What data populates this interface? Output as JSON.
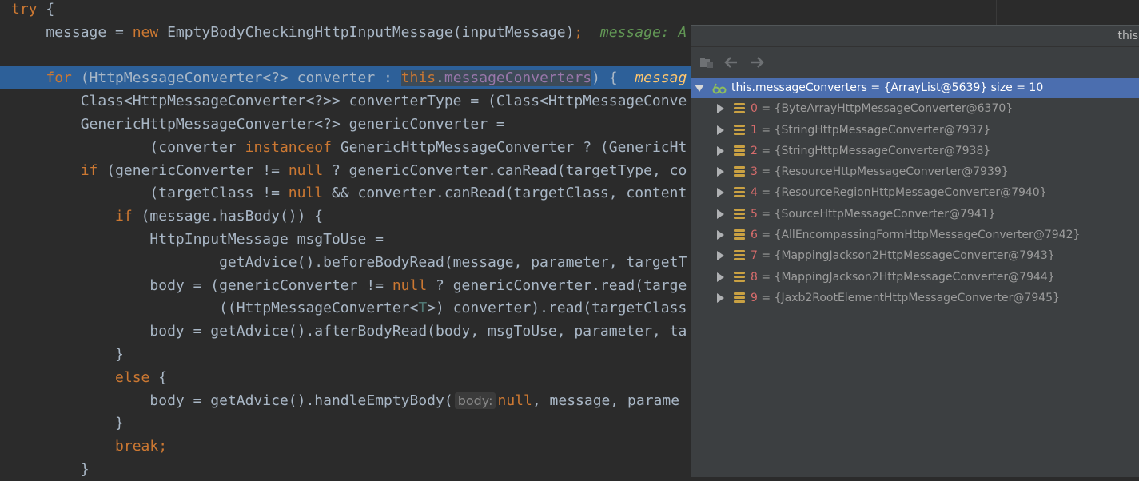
{
  "editor": {
    "lines": [
      [
        {
          "t": "try",
          "c": "kw"
        },
        {
          "t": " {",
          "c": "id"
        }
      ],
      [
        {
          "t": "    message = ",
          "c": "id"
        },
        {
          "t": "new",
          "c": "kw"
        },
        {
          "t": " EmptyBodyCheckingHttpInputMessage(inputMessage)",
          "c": "id"
        },
        {
          "t": ";",
          "c": "kw"
        },
        {
          "t": "  message: ",
          "c": "hint"
        },
        {
          "t": "A",
          "c": "hint"
        }
      ],
      [],
      [
        {
          "t": "    ",
          "c": "id"
        },
        {
          "t": "for",
          "c": "kw"
        },
        {
          "t": " (HttpMessageConverter<?> converter : ",
          "c": "id"
        },
        {
          "t": "this",
          "c": "kw sel"
        },
        {
          "t": ".",
          "c": "id sel"
        },
        {
          "t": "messageConverters",
          "c": "field sel"
        },
        {
          "t": ") {  ",
          "c": "id"
        },
        {
          "t": "messag",
          "c": "inline"
        }
      ],
      [
        {
          "t": "        Class<HttpMessageConverter<?>> converterType = (Class<HttpMessageConve",
          "c": "id"
        }
      ],
      [
        {
          "t": "        GenericHttpMessageConverter<?> genericConverter =",
          "c": "id"
        }
      ],
      [
        {
          "t": "                (converter ",
          "c": "id"
        },
        {
          "t": "instanceof",
          "c": "kw"
        },
        {
          "t": " GenericHttpMessageConverter ? (GenericHt",
          "c": "id"
        }
      ],
      [
        {
          "t": "        ",
          "c": "id"
        },
        {
          "t": "if",
          "c": "kw"
        },
        {
          "t": " (genericConverter != ",
          "c": "id"
        },
        {
          "t": "null",
          "c": "kw"
        },
        {
          "t": " ? genericConverter.canRead(targetType, co",
          "c": "id"
        }
      ],
      [
        {
          "t": "                (targetClass != ",
          "c": "id"
        },
        {
          "t": "null",
          "c": "kw"
        },
        {
          "t": " && converter.canRead(targetClass, content",
          "c": "id"
        }
      ],
      [
        {
          "t": "            ",
          "c": "id"
        },
        {
          "t": "if",
          "c": "kw"
        },
        {
          "t": " (message.hasBody()) {",
          "c": "id"
        }
      ],
      [
        {
          "t": "                HttpInputMessage msgToUse =",
          "c": "id"
        }
      ],
      [
        {
          "t": "                        getAdvice().beforeBodyRead(message, parameter, targetT",
          "c": "id"
        }
      ],
      [
        {
          "t": "                body = (genericConverter != ",
          "c": "id"
        },
        {
          "t": "null",
          "c": "kw"
        },
        {
          "t": " ? genericConverter.read(targe",
          "c": "id"
        }
      ],
      [
        {
          "t": "                        ((HttpMessageConverter<",
          "c": "id"
        },
        {
          "t": "T",
          "c": "typeparam"
        },
        {
          "t": ">) converter).read(targetClass",
          "c": "id"
        }
      ],
      [
        {
          "t": "                body = getAdvice().afterBodyRead(body, msgToUse, parameter, ta",
          "c": "id"
        }
      ],
      [
        {
          "t": "            }",
          "c": "id"
        }
      ],
      [
        {
          "t": "            ",
          "c": "id"
        },
        {
          "t": "else",
          "c": "kw"
        },
        {
          "t": " {",
          "c": "id"
        }
      ],
      [
        {
          "t": "                body = getAdvice().handleEmptyBody(",
          "c": "id"
        },
        {
          "t": "body:",
          "c": "param"
        },
        {
          "t": "null",
          "c": "kw"
        },
        {
          "t": ", message, parame",
          "c": "id"
        }
      ],
      [
        {
          "t": "            }",
          "c": "id"
        }
      ],
      [
        {
          "t": "            ",
          "c": "id"
        },
        {
          "t": "break",
          "c": "kw"
        },
        {
          "t": ";",
          "c": "kw"
        }
      ],
      [
        {
          "t": "        }",
          "c": "id"
        }
      ]
    ],
    "highlight_line": 3
  },
  "popup": {
    "title": "this",
    "toolbar": [
      "show-types-icon",
      "back-icon",
      "forward-icon"
    ],
    "root": {
      "name": "this.messageConverters",
      "value": " = {ArrayList@5639}  size = 10"
    },
    "items": [
      {
        "index": "0",
        "value": " = {ByteArrayHttpMessageConverter@6370}"
      },
      {
        "index": "1",
        "value": " = {StringHttpMessageConverter@7937}"
      },
      {
        "index": "2",
        "value": " = {StringHttpMessageConverter@7938}"
      },
      {
        "index": "3",
        "value": " = {ResourceHttpMessageConverter@7939}"
      },
      {
        "index": "4",
        "value": " = {ResourceRegionHttpMessageConverter@7940}"
      },
      {
        "index": "5",
        "value": " = {SourceHttpMessageConverter@7941}"
      },
      {
        "index": "6",
        "value": " = {AllEncompassingFormHttpMessageConverter@7942}"
      },
      {
        "index": "7",
        "value": " = {MappingJackson2HttpMessageConverter@7943}"
      },
      {
        "index": "8",
        "value": " = {MappingJackson2HttpMessageConverter@7944}"
      },
      {
        "index": "9",
        "value": " = {Jaxb2RootElementHttpMessageConverter@7945}"
      }
    ]
  },
  "colors": {
    "background": "#2b2b2b",
    "keyword": "#cc7832",
    "field": "#9876aa",
    "selection": "#4b6eaf",
    "index": "#d76c6c"
  }
}
